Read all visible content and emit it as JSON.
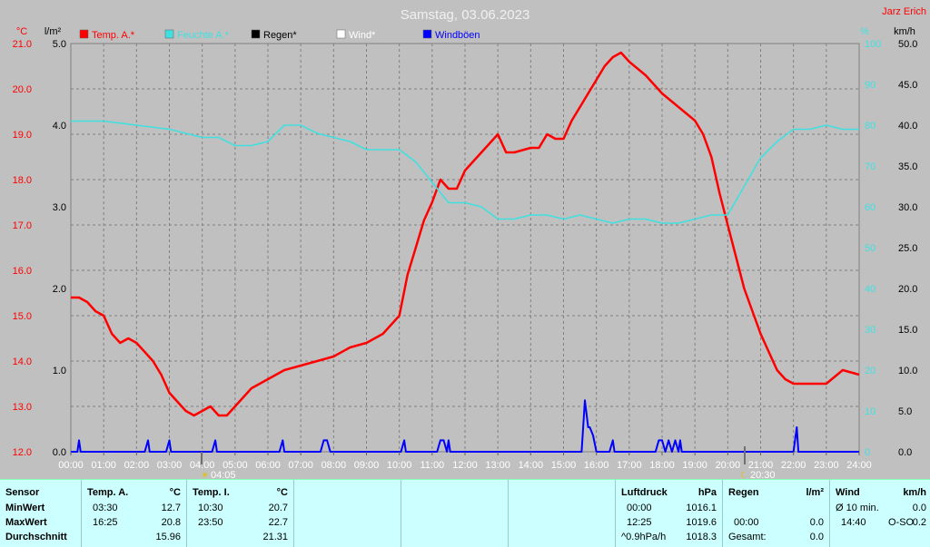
{
  "header": {
    "title": "Samstag, 03.06.2023",
    "author": "Jarz Erich",
    "unit_temp": "°C",
    "unit_rain": "l/m²",
    "unit_pct": "%",
    "unit_wind": "km/h"
  },
  "legend": [
    {
      "label": "Temp. A.*",
      "color": "#ff0000"
    },
    {
      "label": "Feuchte A.*",
      "color": "#40e0e0"
    },
    {
      "label": "Regen*",
      "color": "#000000"
    },
    {
      "label": "Wind*",
      "color": "#ffffff"
    },
    {
      "label": "Windböen",
      "color": "#0000ff"
    }
  ],
  "markers": {
    "sunrise": "04:05",
    "sunset": "20:30"
  },
  "chart_data": {
    "type": "line",
    "title": "Samstag, 03.06.2023",
    "x_ticks": [
      "00:00",
      "01:00",
      "02:00",
      "03:00",
      "04:00",
      "05:00",
      "06:00",
      "07:00",
      "08:00",
      "09:00",
      "10:00",
      "11:00",
      "12:00",
      "13:00",
      "14:00",
      "15:00",
      "16:00",
      "17:00",
      "18:00",
      "19:00",
      "20:00",
      "21:00",
      "22:00",
      "23:00",
      "24:00"
    ],
    "y_axes": {
      "temp": {
        "unit": "°C",
        "range": [
          12.0,
          21.0
        ],
        "ticks": [
          "12.0",
          "13.0",
          "14.0",
          "15.0",
          "16.0",
          "17.0",
          "18.0",
          "19.0",
          "20.0",
          "21.0"
        ]
      },
      "rain": {
        "unit": "l/m²",
        "range": [
          0.0,
          5.0
        ],
        "ticks": [
          "0.0",
          "1.0",
          "2.0",
          "3.0",
          "4.0",
          "5.0"
        ]
      },
      "humidity": {
        "unit": "%",
        "range": [
          0,
          100
        ],
        "ticks": [
          "0",
          "10",
          "20",
          "30",
          "40",
          "50",
          "60",
          "70",
          "80",
          "90",
          "100"
        ]
      },
      "wind": {
        "unit": "km/h",
        "range": [
          0.0,
          50.0
        ],
        "ticks": [
          "0.0",
          "5.0",
          "10.0",
          "15.0",
          "20.0",
          "25.0",
          "30.0",
          "35.0",
          "40.0",
          "45.0",
          "50.0"
        ]
      }
    },
    "grid": true,
    "series": [
      {
        "name": "Temp. A.*",
        "axis": "temp",
        "color": "#ff0000",
        "x": [
          0,
          0.25,
          0.5,
          0.75,
          1,
          1.25,
          1.5,
          1.75,
          2,
          2.25,
          2.5,
          2.75,
          3,
          3.25,
          3.5,
          3.75,
          4,
          4.25,
          4.5,
          4.75,
          5,
          5.5,
          6,
          6.5,
          7,
          7.5,
          8,
          8.5,
          9,
          9.5,
          10,
          10.25,
          10.5,
          10.75,
          11,
          11.25,
          11.5,
          11.75,
          12,
          12.25,
          12.5,
          13,
          13.25,
          13.5,
          14,
          14.25,
          14.5,
          14.75,
          15,
          15.25,
          15.5,
          15.75,
          16,
          16.25,
          16.5,
          16.75,
          17,
          17.5,
          18,
          18.5,
          19,
          19.25,
          19.5,
          19.75,
          20,
          20.5,
          21,
          21.5,
          21.75,
          22,
          22.5,
          23,
          23.5,
          24
        ],
        "values": [
          15.4,
          15.4,
          15.3,
          15.1,
          15.0,
          14.6,
          14.4,
          14.5,
          14.4,
          14.2,
          14.0,
          13.7,
          13.3,
          13.1,
          12.9,
          12.8,
          12.9,
          13.0,
          12.8,
          12.8,
          13.0,
          13.4,
          13.6,
          13.8,
          13.9,
          14.0,
          14.1,
          14.3,
          14.4,
          14.6,
          15.0,
          15.9,
          16.5,
          17.1,
          17.5,
          18.0,
          17.8,
          17.8,
          18.2,
          18.4,
          18.6,
          19.0,
          18.6,
          18.6,
          18.7,
          18.7,
          19.0,
          18.9,
          18.9,
          19.3,
          19.6,
          19.9,
          20.2,
          20.5,
          20.7,
          20.8,
          20.6,
          20.3,
          19.9,
          19.6,
          19.3,
          19.0,
          18.5,
          17.7,
          17.0,
          15.6,
          14.6,
          13.8,
          13.6,
          13.5,
          13.5,
          13.5,
          13.8,
          13.7
        ]
      },
      {
        "name": "Feuchte A.*",
        "axis": "humidity",
        "color": "#40e0e0",
        "x": [
          0,
          1,
          2,
          3,
          4,
          4.5,
          5,
          5.5,
          6,
          6.5,
          7,
          7.5,
          8,
          8.5,
          9,
          10,
          10.5,
          11,
          11.5,
          12,
          12.5,
          13,
          13.5,
          14,
          14.5,
          15,
          15.5,
          16,
          16.5,
          17,
          17.5,
          18,
          18.5,
          19,
          19.5,
          20,
          20.5,
          21,
          21.5,
          22,
          22.5,
          23,
          23.5,
          24
        ],
        "values": [
          81,
          81,
          80,
          79,
          77,
          77,
          75,
          75,
          76,
          80,
          80,
          78,
          77,
          76,
          74,
          74,
          71,
          66,
          61,
          61,
          60,
          57,
          57,
          58,
          58,
          57,
          58,
          57,
          56,
          57,
          57,
          56,
          56,
          57,
          58,
          58,
          65,
          72,
          76,
          79,
          79,
          80,
          79,
          79
        ]
      },
      {
        "name": "Windböen",
        "axis": "wind",
        "color": "#0000ff",
        "x": [
          0,
          0.2,
          0.25,
          0.3,
          2.25,
          2.35,
          2.4,
          2.45,
          2.9,
          3.0,
          3.05,
          3.1,
          4.3,
          4.4,
          4.45,
          4.5,
          6.35,
          6.45,
          6.5,
          6.55,
          7.6,
          7.7,
          7.8,
          7.9,
          10.05,
          10.15,
          10.2,
          10.25,
          11.15,
          11.25,
          11.35,
          11.45,
          11.5,
          11.55,
          15.55,
          15.65,
          15.75,
          15.8,
          15.9,
          16.0,
          16.1,
          16.2,
          16.4,
          16.5,
          16.55,
          16.6,
          17.8,
          17.9,
          18.0,
          18.1,
          18.2,
          18.3,
          18.4,
          18.5,
          18.55,
          18.6,
          22.0,
          22.1,
          22.15,
          22.2,
          24
        ],
        "values": [
          0,
          0,
          1.4,
          0,
          0,
          1.4,
          0,
          0,
          0,
          1.4,
          0,
          0,
          0,
          1.4,
          0,
          0,
          0,
          1.4,
          0,
          0,
          0,
          1.4,
          1.4,
          0,
          0,
          1.4,
          0,
          0,
          0,
          1.4,
          1.4,
          0,
          1.4,
          0,
          0,
          6.3,
          3,
          3,
          2,
          0,
          0,
          0,
          0,
          1.4,
          0,
          0,
          0,
          1.4,
          1.4,
          0,
          1.4,
          0,
          1.4,
          0,
          1.4,
          0,
          0,
          3,
          0,
          0,
          0
        ]
      }
    ]
  },
  "panel": {
    "row_labels": {
      "sensor": "Sensor",
      "min": "MinWert",
      "max": "MaxWert",
      "avg": "Durchschnitt"
    },
    "temp_a": {
      "title": "Temp. A.",
      "unit": "°C",
      "min_time": "03:30",
      "min_val": "12.7",
      "max_time": "16:25",
      "max_val": "20.8",
      "avg": "15.96"
    },
    "temp_i": {
      "title": "Temp. I.",
      "unit": "°C",
      "min_time": "10:30",
      "min_val": "20.7",
      "max_time": "23:50",
      "max_val": "22.7",
      "avg": "21.31"
    },
    "pressure": {
      "title": "Luftdruck",
      "unit": "hPa",
      "min_time": "00:00",
      "min_val": "1016.1",
      "max_time": "12:25",
      "max_val": "1019.6",
      "trend_label": "^0.9hPa/h",
      "trend_val": "1018.3"
    },
    "rain": {
      "title": "Regen",
      "unit": "l/m²",
      "min_time": "00:00",
      "min_val": "0.0",
      "total_label": "Gesamt:",
      "total_val": "0.0"
    },
    "wind": {
      "title": "Wind",
      "unit": "km/h",
      "r1_label": "Ø 10 min.",
      "r1_val": "0.0",
      "r2_time": "14:40",
      "r2_dir": "O-SO",
      "r2_val": "0.2"
    }
  }
}
